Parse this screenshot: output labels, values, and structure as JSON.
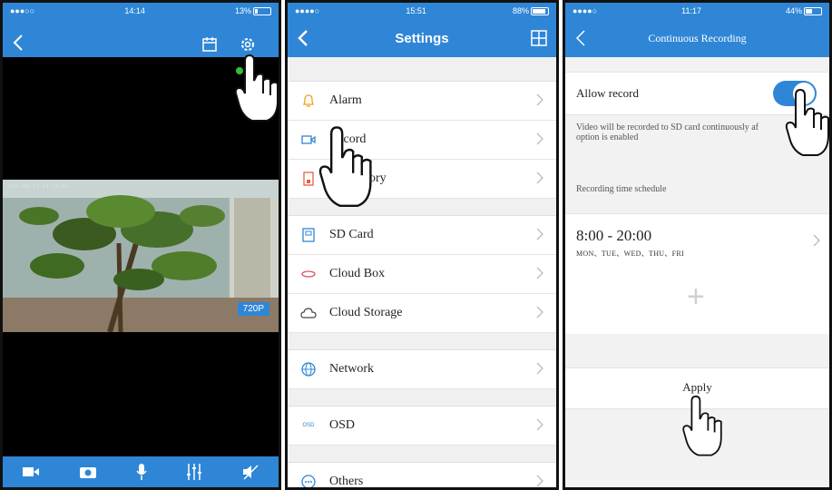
{
  "panel1": {
    "status": {
      "carrier": "●●●○○",
      "time": "14:14",
      "battery": "13%"
    },
    "icons": [
      "back-arrow-icon",
      "calendar-icon",
      "gear-icon"
    ],
    "video_badge": "720P",
    "osd_text": "2016-08-13 14:14:04",
    "bottom_icons": [
      "video-record-icon",
      "camera-icon",
      "microphone-icon",
      "equalizer-icon",
      "mute-speaker-icon"
    ]
  },
  "panel2": {
    "status": {
      "carrier": "●●●●○",
      "time": "15:51",
      "battery": "88%"
    },
    "title": "Settings",
    "groups": [
      {
        "items": [
          {
            "label": "Alarm",
            "icon": "bell-icon"
          },
          {
            "label": "Record",
            "icon": "video-camera-icon"
          },
          {
            "label": "ory",
            "icon": "memory-card-icon"
          }
        ]
      },
      {
        "items": [
          {
            "label": "SD Card",
            "icon": "sd-card-icon"
          },
          {
            "label": "Cloud Box",
            "icon": "cloud-box-icon"
          },
          {
            "label": "Cloud Storage",
            "icon": "cloud-storage-icon"
          }
        ]
      },
      {
        "items": [
          {
            "label": "Network",
            "icon": "globe-icon"
          }
        ]
      },
      {
        "items": [
          {
            "label": "OSD",
            "icon": "osd-icon"
          }
        ]
      },
      {
        "items": [
          {
            "label": "Others",
            "icon": "ellipsis-icon"
          }
        ]
      }
    ],
    "osd_icon_text": "OSD"
  },
  "panel3": {
    "status": {
      "carrier": "●●●●○",
      "time": "11:17",
      "battery": "44%"
    },
    "title": "Continuous Recording",
    "allow_record_label": "Allow record",
    "allow_record_on": true,
    "description": "Video will be recorded to SD card continuously af",
    "description2": "option is enabled",
    "schedule_header": "Recording time schedule",
    "schedule_time": "8:00 - 20:00",
    "schedule_days": "MON、TUE、WED、THU、FRI",
    "add_symbol": "+",
    "apply_label": "Apply"
  }
}
